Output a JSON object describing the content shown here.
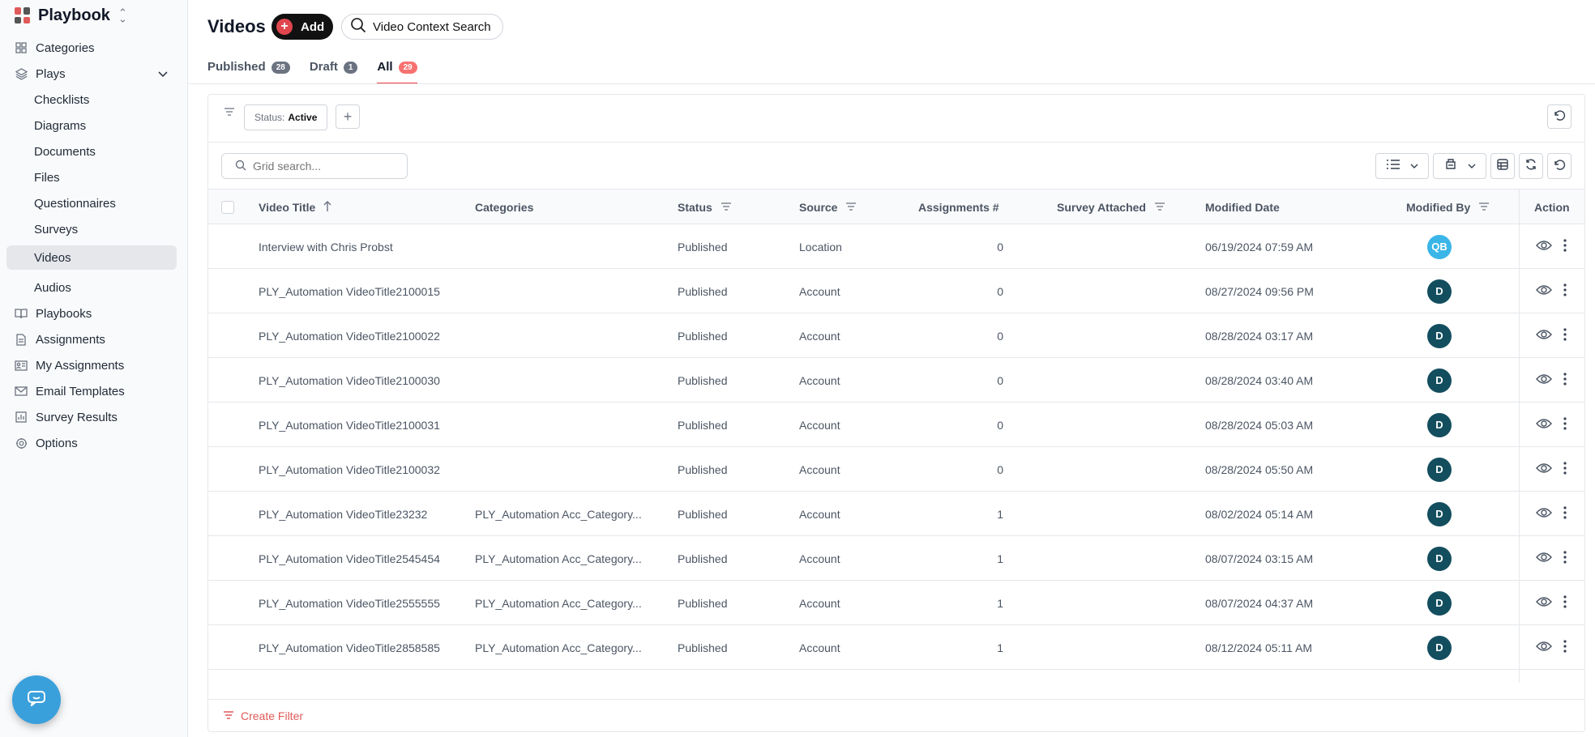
{
  "app": {
    "name": "Playbook"
  },
  "sidebar": {
    "items": [
      {
        "label": "Categories",
        "icon": "grid-icon"
      },
      {
        "label": "Plays",
        "icon": "layers-icon"
      },
      {
        "label": "Checklists"
      },
      {
        "label": "Diagrams"
      },
      {
        "label": "Documents"
      },
      {
        "label": "Files"
      },
      {
        "label": "Questionnaires"
      },
      {
        "label": "Surveys"
      },
      {
        "label": "Videos",
        "active": true
      },
      {
        "label": "Audios"
      },
      {
        "label": "Playbooks",
        "icon": "book-icon"
      },
      {
        "label": "Assignments",
        "icon": "file-icon"
      },
      {
        "label": "My Assignments",
        "icon": "id-card-icon"
      },
      {
        "label": "Email Templates",
        "icon": "mail-icon"
      },
      {
        "label": "Survey Results",
        "icon": "bar-chart-icon"
      },
      {
        "label": "Options",
        "icon": "gear-icon"
      }
    ]
  },
  "header": {
    "title": "Videos",
    "add_label": "Add",
    "context_search_label": "Video Context Search"
  },
  "tabs": [
    {
      "label": "Published",
      "count": "28"
    },
    {
      "label": "Draft",
      "count": "1"
    },
    {
      "label": "All",
      "count": "29",
      "active": true
    }
  ],
  "filters": {
    "status_key": "Status:",
    "status_value": "Active"
  },
  "search": {
    "placeholder": "Grid search..."
  },
  "table": {
    "columns": [
      "Video Title",
      "Categories",
      "Status",
      "Source",
      "Assignments #",
      "Survey Attached",
      "Modified Date",
      "Modified By",
      "Action"
    ],
    "rows": [
      {
        "title": "Interview with Chris Probst",
        "category": "",
        "status": "Published",
        "source": "Location",
        "assignments": "0",
        "survey": "",
        "date": "06/19/2024 07:59 AM",
        "by": "QB",
        "by_color": "#3ab5e8"
      },
      {
        "title": "PLY_Automation VideoTitle2100015",
        "category": "",
        "status": "Published",
        "source": "Account",
        "assignments": "0",
        "survey": "",
        "date": "08/27/2024 09:56 PM",
        "by": "D",
        "by_color": "#134e5e"
      },
      {
        "title": "PLY_Automation VideoTitle2100022",
        "category": "",
        "status": "Published",
        "source": "Account",
        "assignments": "0",
        "survey": "",
        "date": "08/28/2024 03:17 AM",
        "by": "D",
        "by_color": "#134e5e"
      },
      {
        "title": "PLY_Automation VideoTitle2100030",
        "category": "",
        "status": "Published",
        "source": "Account",
        "assignments": "0",
        "survey": "",
        "date": "08/28/2024 03:40 AM",
        "by": "D",
        "by_color": "#134e5e"
      },
      {
        "title": "PLY_Automation VideoTitle2100031",
        "category": "",
        "status": "Published",
        "source": "Account",
        "assignments": "0",
        "survey": "",
        "date": "08/28/2024 05:03 AM",
        "by": "D",
        "by_color": "#134e5e"
      },
      {
        "title": "PLY_Automation VideoTitle2100032",
        "category": "",
        "status": "Published",
        "source": "Account",
        "assignments": "0",
        "survey": "",
        "date": "08/28/2024 05:50 AM",
        "by": "D",
        "by_color": "#134e5e"
      },
      {
        "title": "PLY_Automation VideoTitle23232",
        "category": "PLY_Automation Acc_Category...",
        "status": "Published",
        "source": "Account",
        "assignments": "1",
        "survey": "",
        "date": "08/02/2024 05:14 AM",
        "by": "D",
        "by_color": "#134e5e"
      },
      {
        "title": "PLY_Automation VideoTitle2545454",
        "category": "PLY_Automation Acc_Category...",
        "status": "Published",
        "source": "Account",
        "assignments": "1",
        "survey": "",
        "date": "08/07/2024 03:15 AM",
        "by": "D",
        "by_color": "#134e5e"
      },
      {
        "title": "PLY_Automation VideoTitle2555555",
        "category": "PLY_Automation Acc_Category...",
        "status": "Published",
        "source": "Account",
        "assignments": "1",
        "survey": "",
        "date": "08/07/2024 04:37 AM",
        "by": "D",
        "by_color": "#134e5e"
      },
      {
        "title": "PLY_Automation VideoTitle2858585",
        "category": "PLY_Automation Acc_Category...",
        "status": "Published",
        "source": "Account",
        "assignments": "1",
        "survey": "",
        "date": "08/12/2024 05:11 AM",
        "by": "D",
        "by_color": "#134e5e"
      }
    ]
  },
  "footer": {
    "create_filter_label": "Create Filter"
  },
  "colors": {
    "accent": "#ef4444",
    "avatar_dark": "#134e5e",
    "avatar_light": "#3ab5e8"
  }
}
